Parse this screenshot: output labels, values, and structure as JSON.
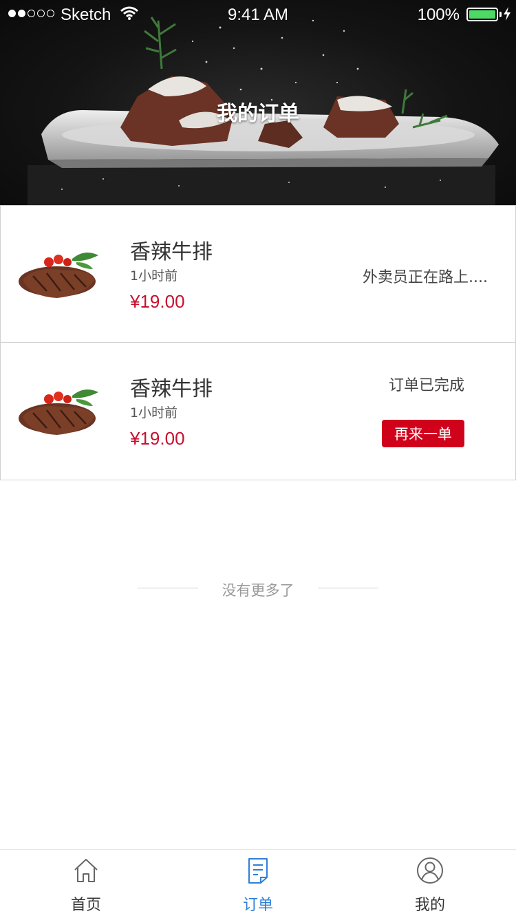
{
  "status_bar": {
    "carrier": "Sketch",
    "time": "9:41 AM",
    "battery_percent": "100%",
    "battery_level": 1.0
  },
  "header": {
    "title": "我的订单"
  },
  "orders": [
    {
      "name": "香辣牛排",
      "time_ago": "1小时前",
      "price": "¥19.00",
      "status": "外卖员正在路上...."
    },
    {
      "name": "香辣牛排",
      "time_ago": "1小时前",
      "price": "¥19.00",
      "status": "订单已完成",
      "action_label": "再来一单"
    }
  ],
  "list_end": {
    "text": "没有更多了"
  },
  "tab_bar": {
    "tabs": [
      {
        "label": "首页",
        "icon": "home-icon",
        "active": false
      },
      {
        "label": "订单",
        "icon": "order-icon",
        "active": true
      },
      {
        "label": "我的",
        "icon": "profile-icon",
        "active": false
      }
    ]
  },
  "colors": {
    "price_red": "#c8102e",
    "button_red": "#d0021b",
    "active_tab_blue": "#2f7fd6",
    "battery_green": "#4cd964"
  }
}
